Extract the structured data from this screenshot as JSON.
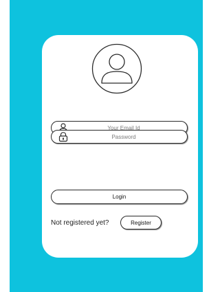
{
  "colors": {
    "background": "#0ec2de",
    "card": "#ffffff",
    "outline": "#2a2a2a"
  },
  "avatar": {
    "icon": "user-avatar-icon"
  },
  "form": {
    "email": {
      "placeholder": "Your Email Id",
      "value": "",
      "icon": "user-icon"
    },
    "password": {
      "placeholder": "Password",
      "value": "",
      "icon": "lock-icon"
    },
    "login_label": "Login"
  },
  "register": {
    "prompt": "Not registered yet?",
    "button_label": "Register"
  }
}
